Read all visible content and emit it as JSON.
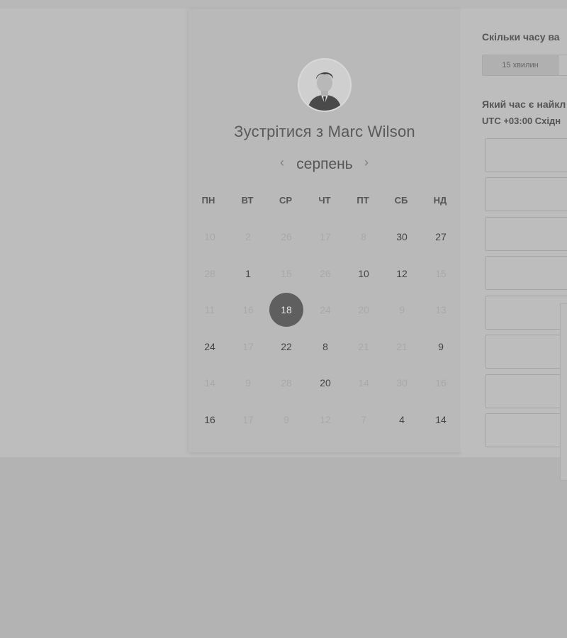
{
  "booking": {
    "host_name": "Marc Wilson",
    "title": "Зустрітися з Marc Wilson",
    "month": "серпень",
    "weekdays": [
      "ПН",
      "ВТ",
      "СР",
      "ЧТ",
      "ПТ",
      "СБ",
      "НД"
    ],
    "weeks": [
      [
        {
          "d": "10",
          "active": false
        },
        {
          "d": "2",
          "active": false
        },
        {
          "d": "26",
          "active": false
        },
        {
          "d": "17",
          "active": false
        },
        {
          "d": "8",
          "active": false
        },
        {
          "d": "30",
          "active": true
        },
        {
          "d": "27",
          "active": true
        }
      ],
      [
        {
          "d": "28",
          "active": false
        },
        {
          "d": "1",
          "active": true
        },
        {
          "d": "15",
          "active": false
        },
        {
          "d": "26",
          "active": false
        },
        {
          "d": "10",
          "active": true
        },
        {
          "d": "12",
          "active": true
        },
        {
          "d": "15",
          "active": false
        }
      ],
      [
        {
          "d": "11",
          "active": false
        },
        {
          "d": "16",
          "active": false
        },
        {
          "d": "18",
          "active": true,
          "selected": true
        },
        {
          "d": "24",
          "active": false
        },
        {
          "d": "20",
          "active": false
        },
        {
          "d": "9",
          "active": false
        },
        {
          "d": "13",
          "active": false
        }
      ],
      [
        {
          "d": "24",
          "active": true
        },
        {
          "d": "17",
          "active": false
        },
        {
          "d": "22",
          "active": true
        },
        {
          "d": "8",
          "active": true
        },
        {
          "d": "21",
          "active": false
        },
        {
          "d": "21",
          "active": false
        },
        {
          "d": "9",
          "active": true
        }
      ],
      [
        {
          "d": "14",
          "active": false
        },
        {
          "d": "9",
          "active": false
        },
        {
          "d": "28",
          "active": false
        },
        {
          "d": "20",
          "active": true
        },
        {
          "d": "14",
          "active": false
        },
        {
          "d": "30",
          "active": false
        },
        {
          "d": "16",
          "active": false
        }
      ],
      [
        {
          "d": "16",
          "active": true
        },
        {
          "d": "17",
          "active": false
        },
        {
          "d": "9",
          "active": false
        },
        {
          "d": "12",
          "active": false
        },
        {
          "d": "7",
          "active": false
        },
        {
          "d": "4",
          "active": true
        },
        {
          "d": "14",
          "active": true
        }
      ]
    ]
  },
  "details": {
    "duration_question": "Скільки часу ва",
    "duration_option": "15 хвилин",
    "time_question": "Який час є найкл",
    "timezone_offset": "UTC +03:00",
    "timezone_name": "Східн"
  },
  "colors": {
    "selected_day": "#5f5f5f",
    "overlay": "#bdbdbd"
  },
  "icons": {
    "prev": "chevron-left-icon",
    "next": "chevron-right-icon"
  }
}
